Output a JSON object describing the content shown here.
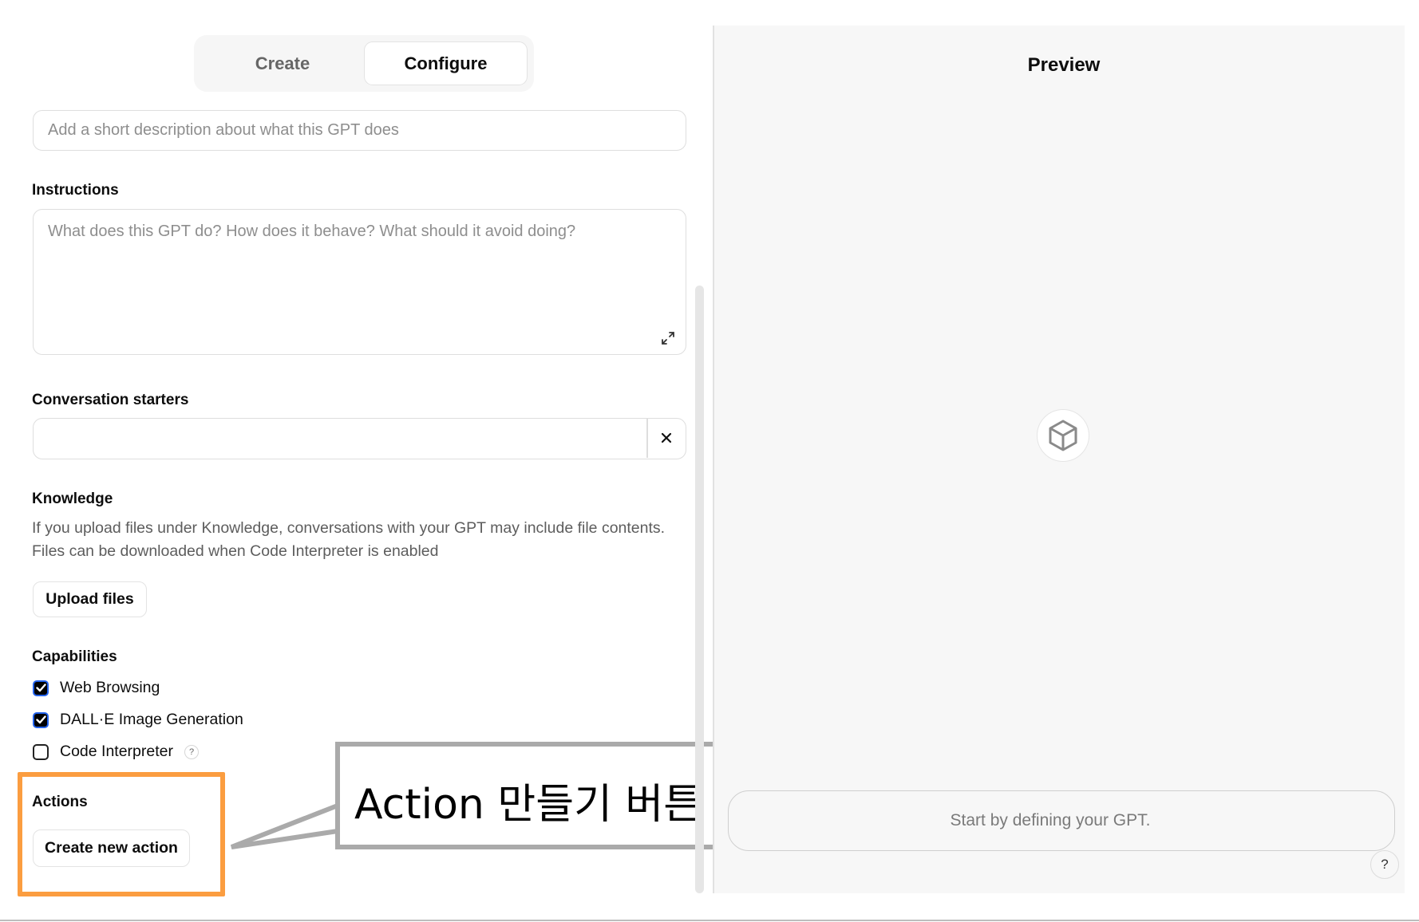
{
  "tabs": {
    "create_label": "Create",
    "configure_label": "Configure",
    "active": "Configure"
  },
  "description": {
    "placeholder": "Add a short description about what this GPT does",
    "value": ""
  },
  "instructions": {
    "label": "Instructions",
    "placeholder": "What does this GPT do? How does it behave? What should it avoid doing?",
    "value": ""
  },
  "conversation_starters": {
    "label": "Conversation starters",
    "value": "",
    "remove_icon": "close-icon"
  },
  "knowledge": {
    "label": "Knowledge",
    "description_line1": "If you upload files under Knowledge, conversations with your GPT may include file contents.",
    "description_line2": "Files can be downloaded when Code Interpreter is enabled",
    "upload_button": "Upload files"
  },
  "capabilities": {
    "label": "Capabilities",
    "items": [
      {
        "label": "Web Browsing",
        "checked": true
      },
      {
        "label": "DALL·E Image Generation",
        "checked": true
      },
      {
        "label": "Code Interpreter",
        "checked": false,
        "help_icon": "?"
      }
    ]
  },
  "actions": {
    "label": "Actions",
    "create_button": "Create new action"
  },
  "annotation": {
    "callout_text": "Action 만들기 버튼",
    "highlight_color": "#fb9d40",
    "callout_border_color": "#aaaaaa"
  },
  "preview": {
    "title": "Preview",
    "center_icon": "cube-icon",
    "input_placeholder": "Start by defining your GPT.",
    "help_label": "?"
  }
}
